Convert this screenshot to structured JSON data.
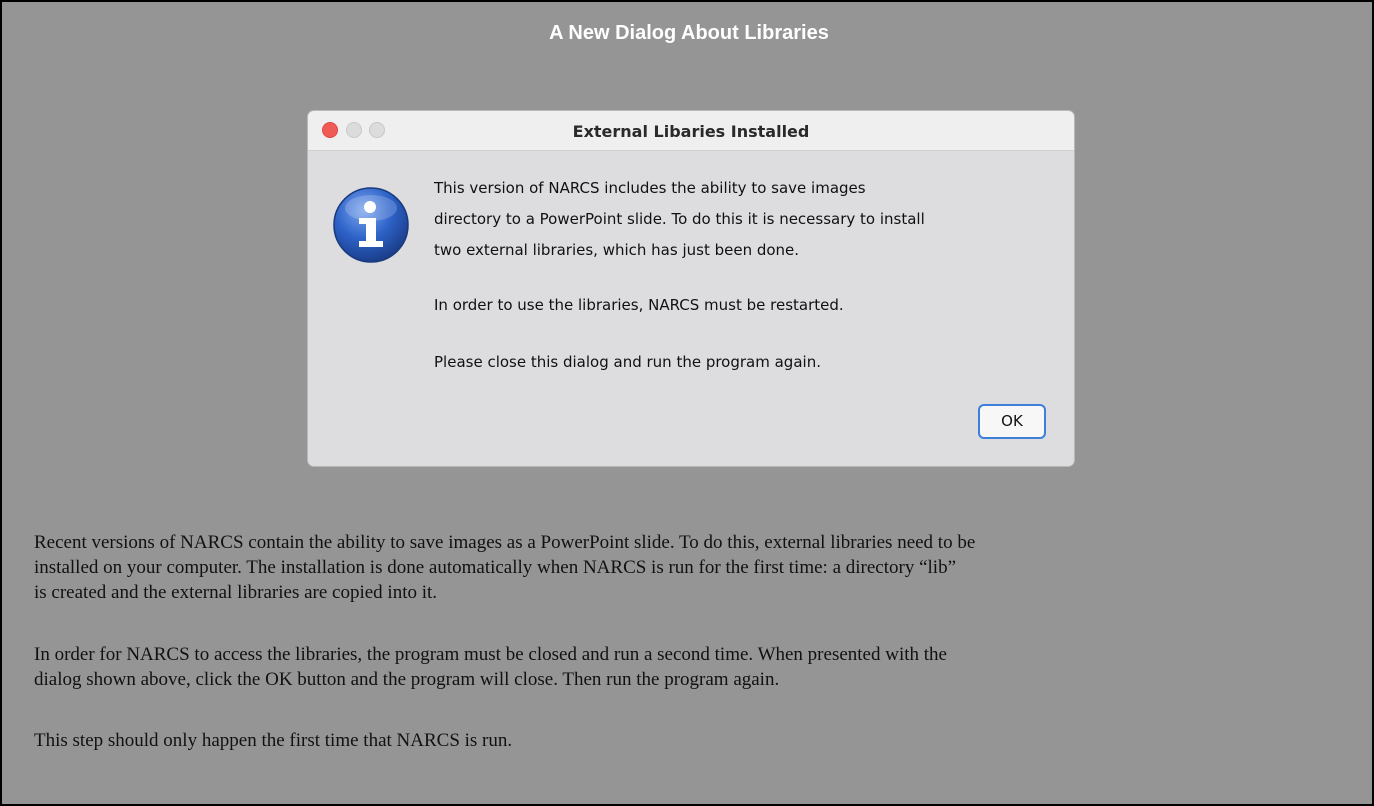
{
  "page": {
    "title": "A New Dialog About Libraries"
  },
  "dialog": {
    "title": "External Libaries Installed",
    "icon": "info-icon",
    "message_lines": [
      "This version of NARCS includes the ability to save images",
      "directory to a PowerPoint slide. To do this it is necessary to install",
      "two external libraries, which has just been done."
    ],
    "restart_note": "In order to use the libraries, NARCS must be restarted.",
    "close_note": "Please close this dialog and run the program again.",
    "ok_label": "OK"
  },
  "body": {
    "paragraph1_lines": [
      "Recent versions of NARCS contain the ability to save images as a PowerPoint slide. To do this, external libraries need to be",
      "installed on your computer. The installation is done automatically when NARCS is run for the first time:  a directory “lib”",
      "is created and the external libraries are copied into it."
    ],
    "paragraph2_lines": [
      "In order for NARCS to access the libraries, the program must be closed and run a second time. When presented with the",
      "dialog shown above, click the OK button and the program will close. Then run the program again."
    ],
    "paragraph3": "This step should only happen the first time that NARCS is run."
  },
  "colors": {
    "background": "#959595",
    "dialog_bg": "#dddcdf",
    "close_button": "#ef5b55",
    "ok_border": "#3d7fd9"
  }
}
